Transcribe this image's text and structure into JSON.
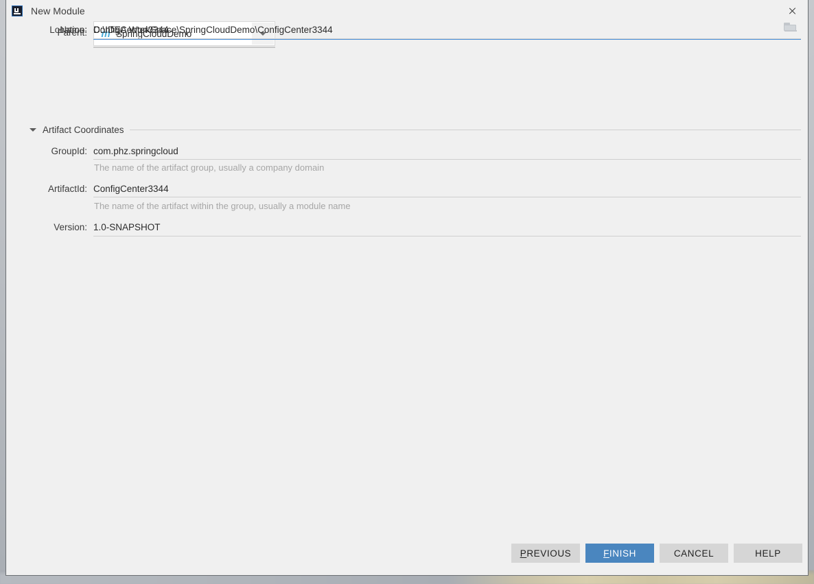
{
  "window": {
    "title": "New Module",
    "app_icon": "intellij-idea-icon",
    "close_icon": "close-icon"
  },
  "form": {
    "parent": {
      "label": "Parent:",
      "value": "SpringCloudDemo",
      "icon": "maven-module-icon",
      "icon_glyph": "m",
      "dropdown_icon": "chevron-down-icon"
    },
    "name": {
      "label": "Name:",
      "value": "ConfigCenter3344",
      "placeholder": "",
      "focused": true
    },
    "location": {
      "label": "Location:",
      "value": "D:\\IDEA WorkSpace\\SpringCloudDemo\\ConfigCenter3344",
      "placeholder": "",
      "browse_icon": "folder-icon"
    }
  },
  "artifact_section": {
    "title": "Artifact Coordinates",
    "expanded": true,
    "toggle_icon": "triangle-down-icon",
    "fields": {
      "groupid": {
        "label": "GroupId:",
        "value": "com.phz.springcloud",
        "hint": "The name of the artifact group, usually a company domain"
      },
      "artifactid": {
        "label": "ArtifactId:",
        "value": "ConfigCenter3344",
        "hint": "The name of the artifact within the group, usually a module name"
      },
      "version": {
        "label": "Version:",
        "value": "1.0-SNAPSHOT",
        "hint": ""
      }
    }
  },
  "buttons": {
    "previous": {
      "mnemonic": "P",
      "rest": "REVIOUS",
      "label": "PREVIOUS"
    },
    "finish": {
      "mnemonic": "F",
      "rest": "INISH",
      "label": "FINISH",
      "primary": true
    },
    "cancel": {
      "label": "CANCEL"
    },
    "help": {
      "label": "HELP"
    }
  },
  "colors": {
    "dialog_background": "#f0f0f0",
    "primary_button": "#4a86bf",
    "focus_underline": "#4a90d9",
    "maven_icon": "#4eaed9",
    "button_face": "#d6d6d6",
    "hint_text": "#a6a6a6"
  }
}
